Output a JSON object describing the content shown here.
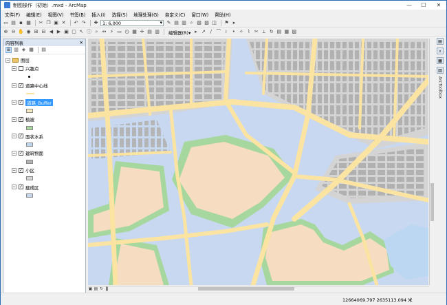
{
  "window": {
    "title": "制图操作（初始）.mxd - ArcMap",
    "minimize": "—",
    "maximize": "☐",
    "close": "✕"
  },
  "menu": [
    "文件(F)",
    "编辑(E)",
    "视图(V)",
    "书签(B)",
    "插入(I)",
    "选择(S)",
    "地理处理(G)",
    "自定义(C)",
    "窗口(W)",
    "帮助(H)"
  ],
  "toolbar": {
    "scale_value": "1: 6,000",
    "editor_label": "编辑器(R)▾"
  },
  "toc": {
    "panel_title": "内容列表",
    "close": "✕",
    "root_label": "图层",
    "layers": [
      {
        "label": "兴趣点",
        "checked": false,
        "symbol": "dot",
        "selected": false
      },
      {
        "label": "道路中心线",
        "checked": true,
        "symbol": "line",
        "selected": false
      },
      {
        "label": "道路_Buffer",
        "checked": true,
        "symbol": "fill",
        "color": "#f6e9c0",
        "selected": true
      },
      {
        "label": "植被",
        "checked": true,
        "symbol": "fill",
        "color": "#a8d8a0",
        "selected": false
      },
      {
        "label": "面状水系",
        "checked": true,
        "symbol": "fill",
        "color": "#bdd5ee",
        "selected": false
      },
      {
        "label": "建筑物面",
        "checked": true,
        "symbol": "fill",
        "color": "#b2b2b2",
        "selected": false
      },
      {
        "label": "小区",
        "checked": true,
        "symbol": "fill",
        "color": "#d6d6d6",
        "selected": false
      },
      {
        "label": "建成区",
        "checked": true,
        "symbol": "fill",
        "color": "#c4d4ea",
        "selected": false
      }
    ]
  },
  "side_panel": {
    "labels": [
      "ArcToolbox"
    ]
  },
  "status": {
    "coordinates": "12664069.797  2635113.094 米"
  },
  "colors": {
    "built_area": "#c8d8f0",
    "road": "#fbe4a2",
    "building": "#b1b1b1",
    "vegetation": "#a6d79e",
    "residential": "#f6dcc0",
    "water": "#bcd7f2"
  }
}
